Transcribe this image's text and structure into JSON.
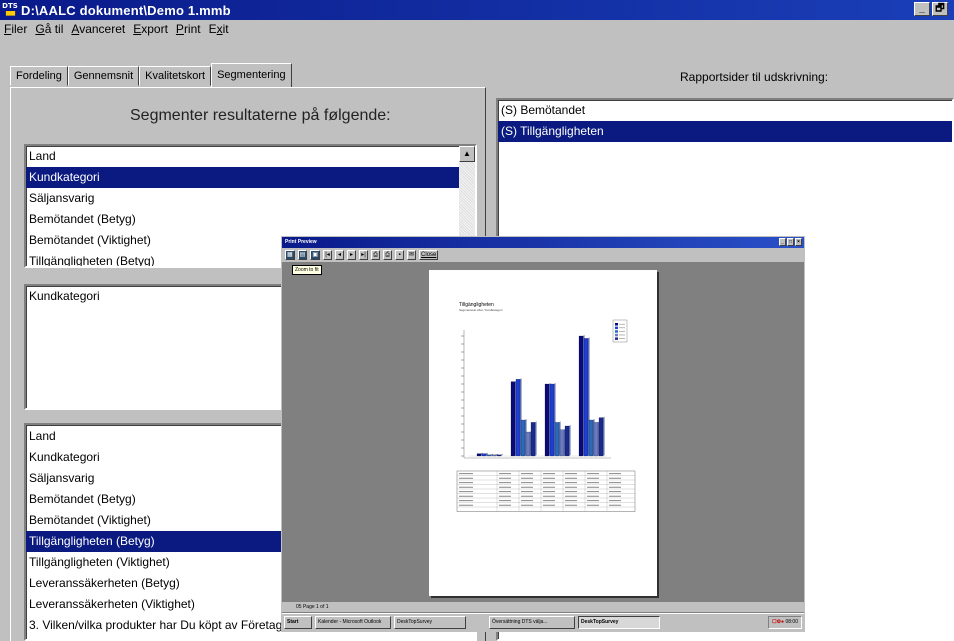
{
  "window": {
    "title": "D:\\AALC dokument\\Demo 1.mmb",
    "icon_label": "DTS",
    "minimize": "_",
    "restore": "🗗"
  },
  "menu": [
    "Filer",
    "Gå til",
    "Avanceret",
    "Export",
    "Print",
    "Exit"
  ],
  "tabs": [
    "Fordeling",
    "Gennemsnit",
    "Kvalitetskort",
    "Segmentering"
  ],
  "active_tab": "Segmentering",
  "segment_heading": "Segmenter resultaterne på følgende:",
  "segment_list": {
    "items": [
      "Land",
      "Kundkategori",
      "Säljansvarig",
      "Bemötandet (Betyg)",
      "Bemötandet (Viktighet)",
      "Tillgängligheten (Betyg)"
    ],
    "selected": "Kundkategori",
    "scroll_up": "▲"
  },
  "selected_segments": [
    "Kundkategori"
  ],
  "question_list": {
    "items": [
      "Land",
      "Kundkategori",
      "Säljansvarig",
      "Bemötandet (Betyg)",
      "Bemötandet (Viktighet)",
      "Tillgängligheten (Betyg)",
      "Tillgängligheten (Viktighet)",
      "Leveranssäkerheten (Betyg)",
      "Leveranssäkerheten (Viktighet)",
      "3. Vilken/vilka produkter har Du köpt av Företaget AB?"
    ],
    "selected": "Tillgängligheten (Betyg)"
  },
  "report_pages": {
    "label": "Rapportsider til udskrivning:",
    "items": [
      "(S) Bemötandet",
      "(S) Tillgängligheten"
    ],
    "selected": "(S) Tillgängligheten"
  },
  "print_preview": {
    "title": "Print Preview",
    "tooltip": "Zoom to fit",
    "close_label": "Close",
    "page_status": "05  Page 1 of 1",
    "report_title": "Tillgängligheten",
    "report_subtitle": "Segmenterat efter: Kundkategori"
  },
  "taskbar": {
    "start": "Start",
    "buttons": [
      "Kalender - Microsoft Outlook",
      "DeskTopSurvey",
      "Översättning DTS välja...",
      "DeskTopSurvey"
    ],
    "active_index": 3,
    "tray_time": "08:00"
  },
  "colors": {
    "titlebar": "#0a1a8a",
    "selection": "#0a1a80",
    "chart_series": [
      "#0a0a7a",
      "#1e3fd0",
      "#2a6ab8",
      "#6c7ac0",
      "#1c2a8c"
    ]
  }
}
